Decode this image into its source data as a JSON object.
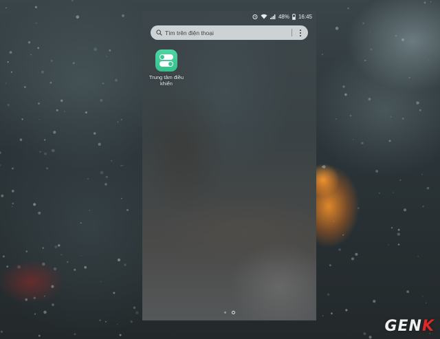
{
  "status_bar": {
    "battery_percent": "48%",
    "time": "16:45",
    "icons": [
      "alarm-icon",
      "wifi-icon",
      "signal-icon",
      "battery-icon"
    ]
  },
  "search": {
    "placeholder": "Tìm trên điện thoại",
    "search_icon": "search-icon",
    "menu_icon": "more-vertical-icon"
  },
  "apps": [
    {
      "label": "Trung tâm điều khiển",
      "icon": "toggle-switches-icon",
      "color": "#3fcb96"
    }
  ],
  "pager": {
    "page_count": 2,
    "current_page": 2
  },
  "watermark": {
    "text_main": "GEN",
    "text_accent": "K",
    "accent_color": "#e02828"
  },
  "colors": {
    "app_icon_green": "#3fcb96",
    "search_bar_bg": "#e1e6e8"
  }
}
